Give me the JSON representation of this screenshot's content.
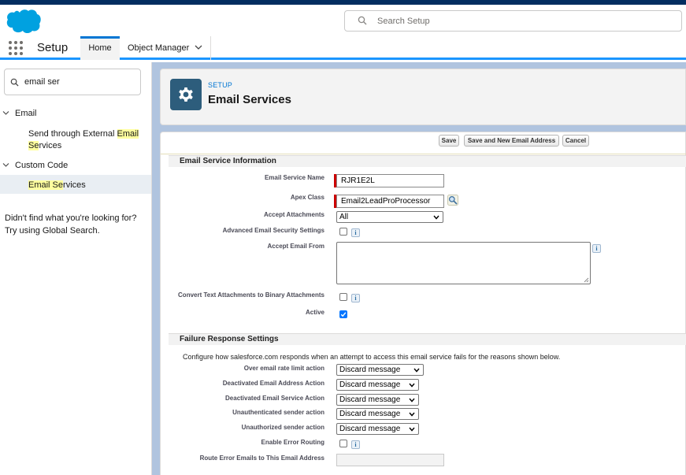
{
  "header": {
    "search_placeholder": "Search Setup"
  },
  "nav": {
    "app_name": "Setup",
    "tabs": [
      {
        "label": "Home"
      },
      {
        "label": "Object Manager"
      }
    ]
  },
  "sidebar": {
    "quick_find_value": "email ser",
    "groups": [
      {
        "label": "Email",
        "items": [
          {
            "pre": "Send through External ",
            "hl1": "Email",
            "line2_hl": "Se",
            "line2_rest": "rvices"
          }
        ]
      },
      {
        "label": "Custom Code",
        "items": [
          {
            "hl1": "Email Se",
            "rest": "rvices"
          }
        ]
      }
    ],
    "no_find_line1": "Didn't find what you're looking for?",
    "no_find_line2": "Try using Global Search."
  },
  "page": {
    "breadcrumb": "SETUP",
    "title": "Email Services",
    "icon": "gear-icon"
  },
  "buttons": {
    "save": "Save",
    "save_new": "Save and New Email Address",
    "cancel": "Cancel"
  },
  "info_section": {
    "title": "Email Service Information",
    "fields": {
      "service_name_label": "Email Service Name",
      "service_name_value": "RJR1E2L",
      "apex_class_label": "Apex Class",
      "apex_class_value": "Email2LeadProProcessor",
      "accept_attachments_label": "Accept Attachments",
      "accept_attachments_value": "All",
      "adv_security_label": "Advanced Email Security Settings",
      "adv_security_checked": false,
      "accept_from_label": "Accept Email From",
      "accept_from_value": "",
      "convert_label": "Convert Text Attachments to Binary Attachments",
      "convert_checked": false,
      "active_label": "Active",
      "active_checked": true
    }
  },
  "failure_section": {
    "title": "Failure Response Settings",
    "description": "Configure how salesforce.com responds when an attempt to access this email service fails for the reasons shown below.",
    "rows": [
      {
        "label": "Over email rate limit action",
        "value": "Discard message"
      },
      {
        "label": "Deactivated Email Address Action",
        "value": "Discard message"
      },
      {
        "label": "Deactivated Email Service Action",
        "value": "Discard message"
      },
      {
        "label": "Unauthenticated sender action",
        "value": "Discard message"
      },
      {
        "label": "Unauthorized sender action",
        "value": "Discard message"
      }
    ],
    "error_routing_label": "Enable Error Routing",
    "error_routing_checked": false,
    "route_errors_label": "Route Error Emails to This Email Address",
    "route_errors_value": ""
  },
  "colors": {
    "brand_blue": "#0176d3",
    "header_navy": "#032d60",
    "content_bg": "#b0c4df",
    "icon_bg": "#2d5d7c",
    "required": "#cc0000",
    "highlight": "#ffff9f"
  }
}
